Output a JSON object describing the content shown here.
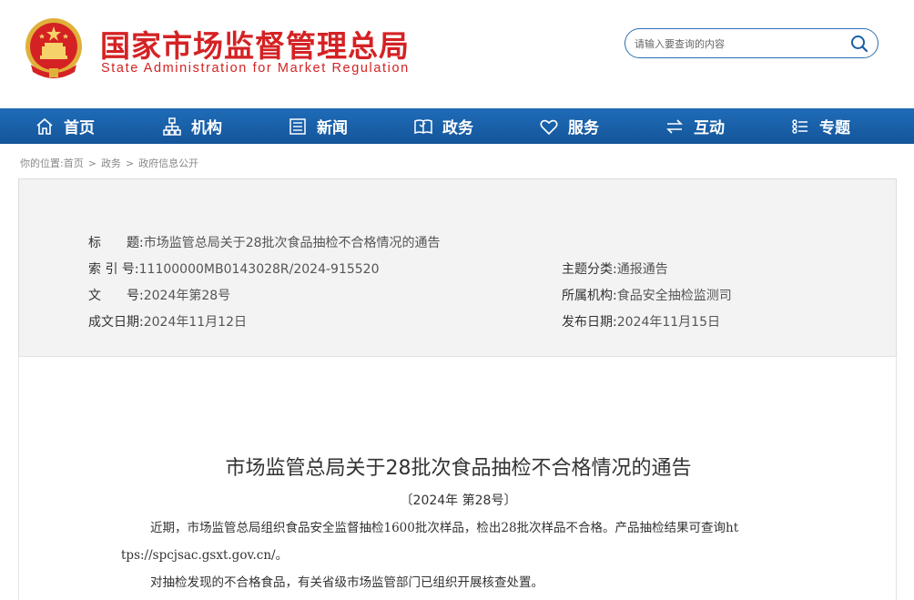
{
  "header": {
    "title_cn": "国家市场监督管理总局",
    "title_en": "State Administration for Market Regulation",
    "search_placeholder": "请输入要查询的内容"
  },
  "nav": {
    "items": [
      {
        "label": "首页",
        "icon": "home-icon"
      },
      {
        "label": "机构",
        "icon": "org-chart-icon"
      },
      {
        "label": "新闻",
        "icon": "newspaper-icon"
      },
      {
        "label": "政务",
        "icon": "book-icon"
      },
      {
        "label": "服务",
        "icon": "heart-icon"
      },
      {
        "label": "互动",
        "icon": "swap-arrows-icon"
      },
      {
        "label": "专题",
        "icon": "topic-list-icon"
      }
    ]
  },
  "breadcrumb": {
    "prefix": "你的位置:",
    "items": [
      "首页",
      "政务",
      "政府信息公开"
    ],
    "separator": ">"
  },
  "info": {
    "title_label": "标　　题:",
    "title_value": "市场监管总局关于28批次食品抽检不合格情况的通告",
    "index_label": "索 引 号:",
    "index_value": "11100000MB0143028R/2024-915520",
    "docno_label": "文　　号:",
    "docno_value": "2024年第28号",
    "date_label": "成文日期:",
    "date_value": "2024年11月12日",
    "topic_label": "主题分类:",
    "topic_value": "通报通告",
    "org_label": "所属机构:",
    "org_value": "食品安全抽检监测司",
    "pubdate_label": "发布日期:",
    "pubdate_value": "2024年11月15日"
  },
  "article": {
    "title": "市场监管总局关于28批次食品抽检不合格情况的通告",
    "doc_number": "〔2024年 第28号〕",
    "para1_line1": "近期，市场监管总局组织食品安全监督抽检1600批次样品，检出28批次样品不合格。产品抽检结果可查询ht",
    "para1_line2": "tps://spcjsac.gsxt.gov.cn/。",
    "para2": "对抽检发现的不合格食品，有关省级市场监管部门已组织开展核查处置。"
  },
  "colors": {
    "brand_red": "#d42224",
    "nav_blue": "#1a63ad",
    "panel_bg": "#f3f3f3"
  }
}
